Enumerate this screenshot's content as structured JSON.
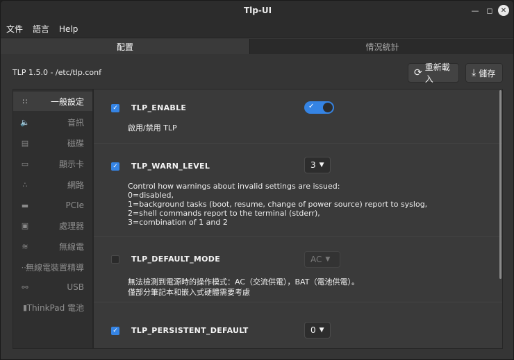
{
  "window": {
    "title": "Tlp-UI"
  },
  "menu": [
    "文件",
    "語言",
    "Help"
  ],
  "tabs": [
    "配置",
    "情況統計"
  ],
  "header": {
    "path": "TLP 1.5.0 - /etc/tlp.conf",
    "reload_label": "重新載入",
    "save_label": "儲存"
  },
  "sidebar": {
    "items": [
      {
        "label": "一般設定",
        "icon": "grid-icon",
        "active": true
      },
      {
        "label": "音訊",
        "icon": "speaker-icon"
      },
      {
        "label": "磁碟",
        "icon": "disk-icon"
      },
      {
        "label": "顯示卡",
        "icon": "monitor-icon"
      },
      {
        "label": "網路",
        "icon": "network-icon"
      },
      {
        "label": "PCIe",
        "icon": "pcie-icon"
      },
      {
        "label": "處理器",
        "icon": "cpu-icon"
      },
      {
        "label": "無線電",
        "icon": "wifi-icon"
      },
      {
        "label": "無線電裝置精導",
        "icon": "dots-icon"
      },
      {
        "label": "USB",
        "icon": "usb-icon"
      },
      {
        "label": "ThinkPad 電池",
        "icon": "battery-icon"
      }
    ]
  },
  "settings": [
    {
      "name": "TLP_ENABLE",
      "checked": true,
      "control": "toggle",
      "toggle_on": true,
      "desc": "啟用/禁用 TLP"
    },
    {
      "name": "TLP_WARN_LEVEL",
      "checked": true,
      "control": "dropdown",
      "value": "3",
      "desc": "Control how warnings about invalid settings are issued:\n0=disabled,\n1=background tasks (boot, resume, change of power source) report to syslog,\n2=shell commands report to the terminal (stderr),\n3=combination of 1 and 2"
    },
    {
      "name": "TLP_DEFAULT_MODE",
      "checked": false,
      "control": "dropdown",
      "value": "AC",
      "disabled": true,
      "desc": "無法檢測到電源時的操作模式：AC（交流供電），BAT（電池供電）。\n僅部分筆記本和嵌入式硬體需要考慮"
    },
    {
      "name": "TLP_PERSISTENT_DEFAULT",
      "checked": true,
      "control": "dropdown",
      "value": "0",
      "desc": ""
    }
  ],
  "colors": {
    "accent": "#3584e4",
    "background": "#353535"
  }
}
